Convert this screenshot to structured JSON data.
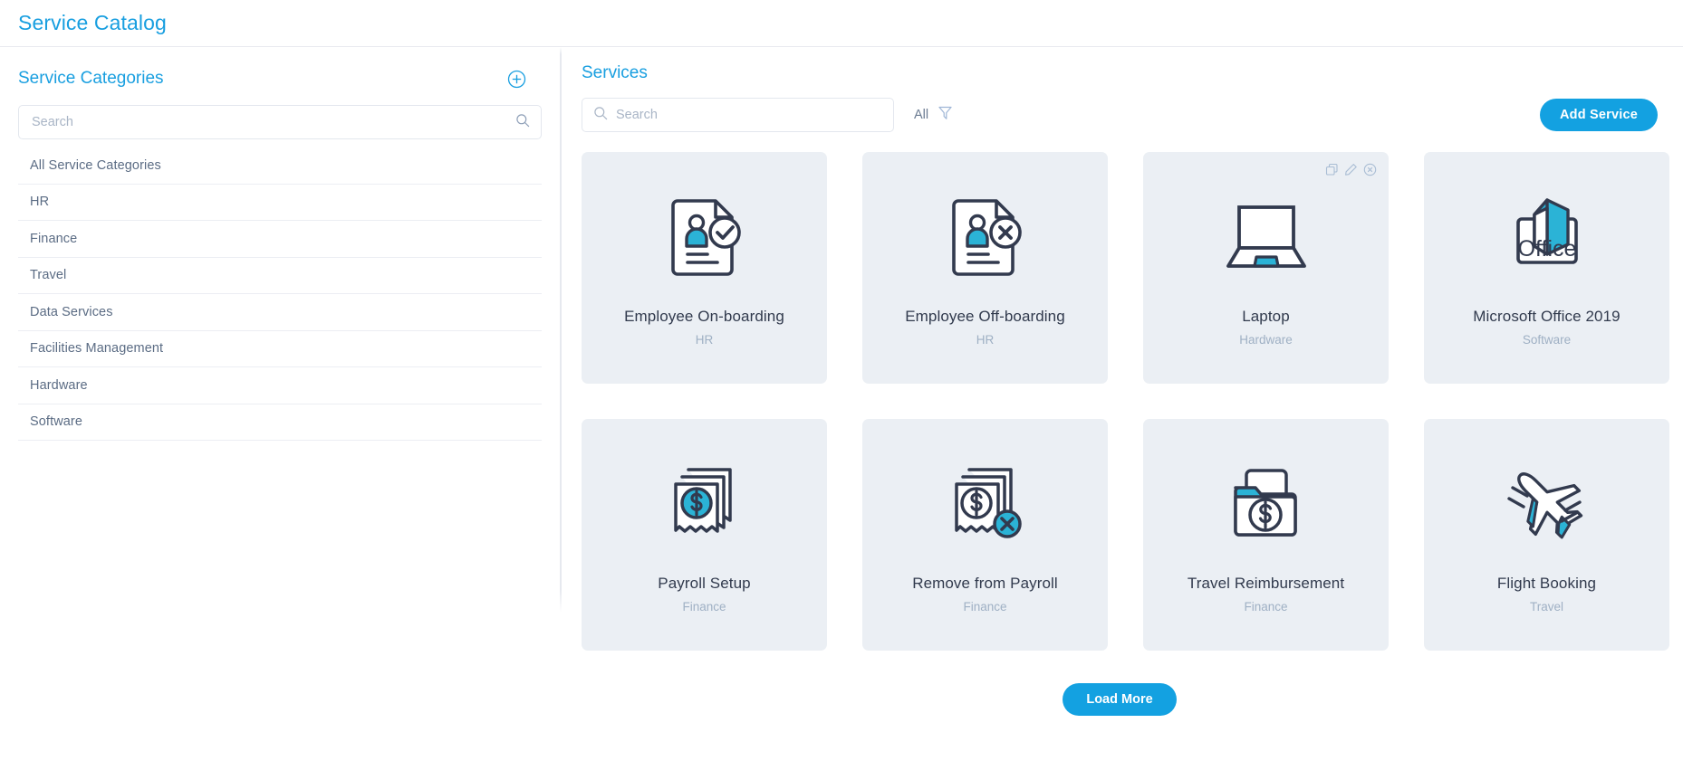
{
  "app": {
    "title": "Service Catalog",
    "accent_color": "#199fe0",
    "button_color": "#13a1e1",
    "card_bg_color": "#ebeff4",
    "icon_dark_color": "#323a4e",
    "icon_accent_color": "#2bb3d6"
  },
  "sidebar": {
    "title": "Service Categories",
    "add_icon": "plus-circle-icon",
    "search": {
      "placeholder": "Search",
      "value": "",
      "icon": "search-icon"
    },
    "items": [
      {
        "label": "All Service Categories"
      },
      {
        "label": "HR"
      },
      {
        "label": "Finance"
      },
      {
        "label": "Travel"
      },
      {
        "label": "Data Services"
      },
      {
        "label": "Facilities Management"
      },
      {
        "label": "Hardware"
      },
      {
        "label": "Software"
      }
    ]
  },
  "main": {
    "title": "Services",
    "search": {
      "placeholder": "Search",
      "value": "",
      "icon": "search-icon"
    },
    "filter": {
      "label": "All",
      "icon": "funnel-icon"
    },
    "add_service_label": "Add Service",
    "load_more_label": "Load More",
    "card_actions": [
      {
        "name": "duplicate-icon",
        "label": "Duplicate"
      },
      {
        "name": "edit-icon",
        "label": "Edit"
      },
      {
        "name": "delete-icon",
        "label": "Delete"
      }
    ],
    "services": [
      {
        "title": "Employee On-boarding",
        "category": "HR",
        "icon": "document-person-check-icon",
        "actions_visible": false
      },
      {
        "title": "Employee Off-boarding",
        "category": "HR",
        "icon": "document-person-x-icon",
        "actions_visible": false
      },
      {
        "title": "Laptop",
        "category": "Hardware",
        "icon": "laptop-icon",
        "actions_visible": true
      },
      {
        "title": "Microsoft Office 2019",
        "category": "Software",
        "icon": "office-icon",
        "actions_visible": false
      },
      {
        "title": "Payroll Setup",
        "category": "Finance",
        "icon": "receipts-dollar-icon",
        "actions_visible": false
      },
      {
        "title": "Remove from Payroll",
        "category": "Finance",
        "icon": "receipts-dollar-x-icon",
        "actions_visible": false
      },
      {
        "title": "Travel Reimbursement",
        "category": "Finance",
        "icon": "folder-dollar-icon",
        "actions_visible": false
      },
      {
        "title": "Flight Booking",
        "category": "Travel",
        "icon": "airplane-icon",
        "actions_visible": false
      }
    ]
  }
}
